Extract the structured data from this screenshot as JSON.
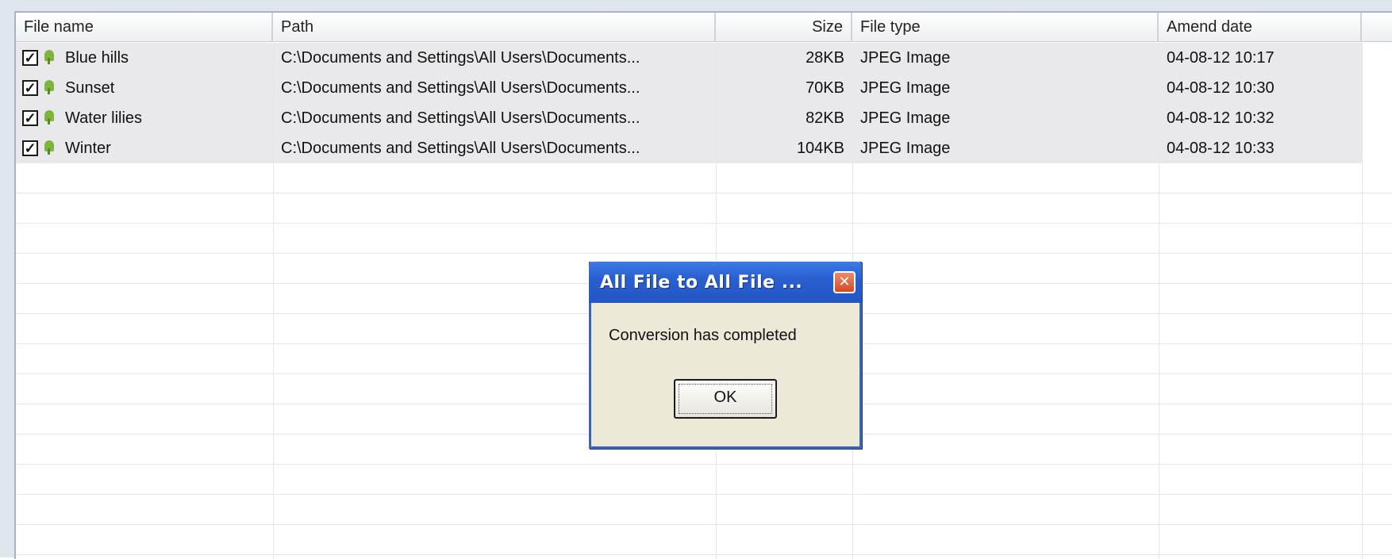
{
  "columns": [
    {
      "label": "File name"
    },
    {
      "label": "Path"
    },
    {
      "label": "Size"
    },
    {
      "label": "File type"
    },
    {
      "label": "Amend date"
    }
  ],
  "rows": [
    {
      "name": "Blue hills",
      "path": "C:\\Documents and Settings\\All Users\\Documents...",
      "size": "28KB",
      "type": "JPEG Image",
      "date": "04-08-12 10:17"
    },
    {
      "name": "Sunset",
      "path": "C:\\Documents and Settings\\All Users\\Documents...",
      "size": "70KB",
      "type": "JPEG Image",
      "date": "04-08-12 10:30"
    },
    {
      "name": "Water lilies",
      "path": "C:\\Documents and Settings\\All Users\\Documents...",
      "size": "82KB",
      "type": "JPEG Image",
      "date": "04-08-12 10:32"
    },
    {
      "name": "Winter",
      "path": "C:\\Documents and Settings\\All Users\\Documents...",
      "size": "104KB",
      "type": "JPEG Image",
      "date": "04-08-12 10:33"
    }
  ],
  "dialog": {
    "title": "All File to All File ...",
    "message": "Conversion has completed",
    "ok_label": "OK",
    "close_glyph": "✕"
  },
  "icons": {
    "checkbox": "checkbox-icon",
    "file": "image-file-icon",
    "close": "close-icon"
  },
  "colors": {
    "titlebar": "#2a5fd0",
    "row_background": "#e9e9ec",
    "close_button": "#d24a22"
  }
}
